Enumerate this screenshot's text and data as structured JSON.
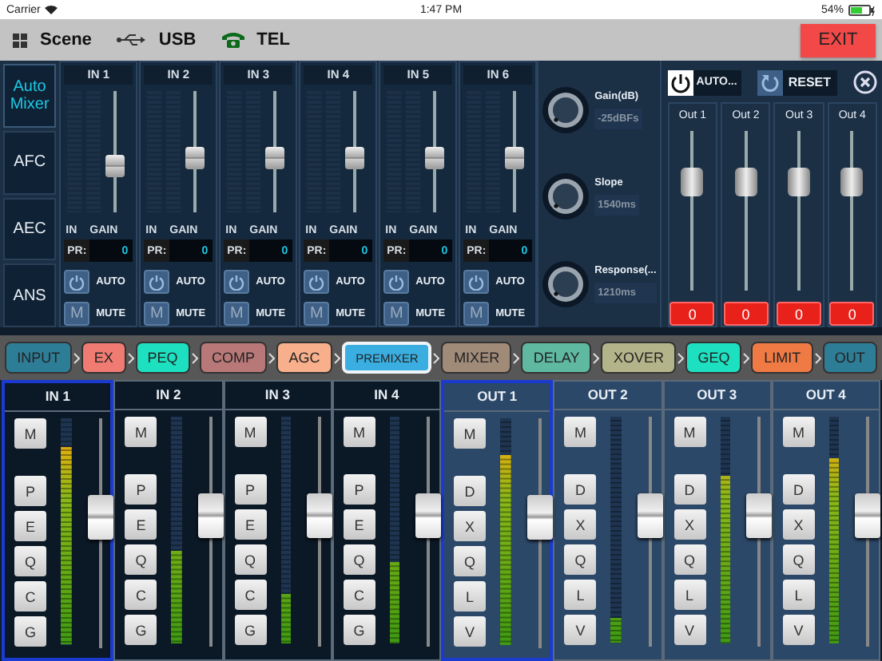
{
  "status_bar": {
    "carrier": "Carrier",
    "time": "1:47 PM",
    "battery": "54%"
  },
  "toolbar": {
    "items": [
      {
        "kind": "scene",
        "label": "Scene"
      },
      {
        "kind": "usb",
        "label": "USB"
      },
      {
        "kind": "tel",
        "label": "TEL"
      }
    ],
    "exit": "EXIT"
  },
  "modes": [
    {
      "label": "Auto Mixer",
      "selected": true
    },
    {
      "label": "AFC",
      "selected": false
    },
    {
      "label": "AEC",
      "selected": false
    },
    {
      "label": "ANS",
      "selected": false
    }
  ],
  "mixer_inputs": [
    {
      "name": "IN 1",
      "level": 0.36,
      "in_label": "IN",
      "gain_label": "GAIN",
      "pr_label": "PR:",
      "pr_value": "0",
      "auto_label": "AUTO",
      "mute_key": "M",
      "mute_label": "MUTE"
    },
    {
      "name": "IN 2",
      "level": 0.43,
      "in_label": "IN",
      "gain_label": "GAIN",
      "pr_label": "PR:",
      "pr_value": "0",
      "auto_label": "AUTO",
      "mute_key": "M",
      "mute_label": "MUTE"
    },
    {
      "name": "IN 3",
      "level": 0.43,
      "in_label": "IN",
      "gain_label": "GAIN",
      "pr_label": "PR:",
      "pr_value": "0",
      "auto_label": "AUTO",
      "mute_key": "M",
      "mute_label": "MUTE"
    },
    {
      "name": "IN 4",
      "level": 0.43,
      "in_label": "IN",
      "gain_label": "GAIN",
      "pr_label": "PR:",
      "pr_value": "0",
      "auto_label": "AUTO",
      "mute_key": "M",
      "mute_label": "MUTE"
    },
    {
      "name": "IN 5",
      "level": 0.43,
      "in_label": "IN",
      "gain_label": "GAIN",
      "pr_label": "PR:",
      "pr_value": "0",
      "auto_label": "AUTO",
      "mute_key": "M",
      "mute_label": "MUTE"
    },
    {
      "name": "IN 6",
      "level": 0.43,
      "in_label": "IN",
      "gain_label": "GAIN",
      "pr_label": "PR:",
      "pr_value": "0",
      "auto_label": "AUTO",
      "mute_key": "M",
      "mute_label": "MUTE"
    }
  ],
  "controls": {
    "knobs": [
      {
        "label": "Gain(dB)",
        "value": "-25dBFs"
      },
      {
        "label": "Slope",
        "value": "1540ms"
      },
      {
        "label": "Response(...",
        "value": "1210ms"
      }
    ],
    "auto_button": "AUTO...",
    "reset_button": "RESET"
  },
  "mixer_outputs": [
    {
      "name": "Out 1",
      "level": 0.72,
      "value": "0"
    },
    {
      "name": "Out 2",
      "level": 0.72,
      "value": "0"
    },
    {
      "name": "Out 3",
      "level": 0.72,
      "value": "0"
    },
    {
      "name": "Out 4",
      "level": 0.72,
      "value": "0"
    }
  ],
  "chain": [
    {
      "label": "INPUT",
      "color": "#2e7d97",
      "selected": false
    },
    {
      "label": "EX",
      "color": "#ef7b72",
      "selected": false
    },
    {
      "label": "PEQ",
      "color": "#1de0c0",
      "selected": false
    },
    {
      "label": "COMP",
      "color": "#b87878",
      "selected": false
    },
    {
      "label": "AGC",
      "color": "#f8b08c",
      "selected": false
    },
    {
      "label": "PREMIXER",
      "color": "#3aaee0",
      "selected": true
    },
    {
      "label": "MIXER",
      "color": "#a08a78",
      "selected": false
    },
    {
      "label": "DELAY",
      "color": "#5fb8a0",
      "selected": false
    },
    {
      "label": "XOVER",
      "color": "#b4b48a",
      "selected": false
    },
    {
      "label": "GEQ",
      "color": "#1de0c0",
      "selected": false
    },
    {
      "label": "LIMIT",
      "color": "#f07a44",
      "selected": false
    },
    {
      "label": "OUT",
      "color": "#2e7d97",
      "selected": false
    }
  ],
  "channels": [
    {
      "kind": "input",
      "name": "IN 1",
      "selected": true,
      "buttons": [
        "M",
        "P",
        "E",
        "Q",
        "C",
        "G"
      ],
      "meter": {
        "level": 0.87
      },
      "fader": {
        "level": 0.59
      }
    },
    {
      "kind": "input",
      "name": "IN 2",
      "selected": false,
      "buttons": [
        "M",
        "P",
        "E",
        "Q",
        "C",
        "G"
      ],
      "meter": {
        "level": 0.41
      },
      "fader": {
        "level": 0.59
      }
    },
    {
      "kind": "input",
      "name": "IN 3",
      "selected": false,
      "buttons": [
        "M",
        "P",
        "E",
        "Q",
        "C",
        "G"
      ],
      "meter": {
        "level": 0.22
      },
      "fader": {
        "level": 0.59
      }
    },
    {
      "kind": "input",
      "name": "IN 4",
      "selected": false,
      "buttons": [
        "M",
        "P",
        "E",
        "Q",
        "C",
        "G"
      ],
      "meter": {
        "level": 0.36
      },
      "fader": {
        "level": 0.59
      }
    },
    {
      "kind": "output",
      "name": "OUT 1",
      "selected": true,
      "buttons": [
        "M",
        "D",
        "X",
        "Q",
        "L",
        "V"
      ],
      "meter": {
        "level": 0.84
      },
      "fader": {
        "level": 0.59
      }
    },
    {
      "kind": "output",
      "name": "OUT 2",
      "selected": false,
      "buttons": [
        "M",
        "D",
        "X",
        "Q",
        "L",
        "V"
      ],
      "meter": {
        "level": 0.11
      },
      "fader": {
        "level": 0.59
      }
    },
    {
      "kind": "output",
      "name": "OUT 3",
      "selected": false,
      "buttons": [
        "M",
        "D",
        "X",
        "Q",
        "L",
        "V"
      ],
      "meter": {
        "level": 0.74
      },
      "fader": {
        "level": 0.59
      }
    },
    {
      "kind": "output",
      "name": "OUT 4",
      "selected": false,
      "buttons": [
        "M",
        "D",
        "X",
        "Q",
        "L",
        "V"
      ],
      "meter": {
        "level": 0.82
      },
      "fader": {
        "level": 0.59
      }
    }
  ]
}
